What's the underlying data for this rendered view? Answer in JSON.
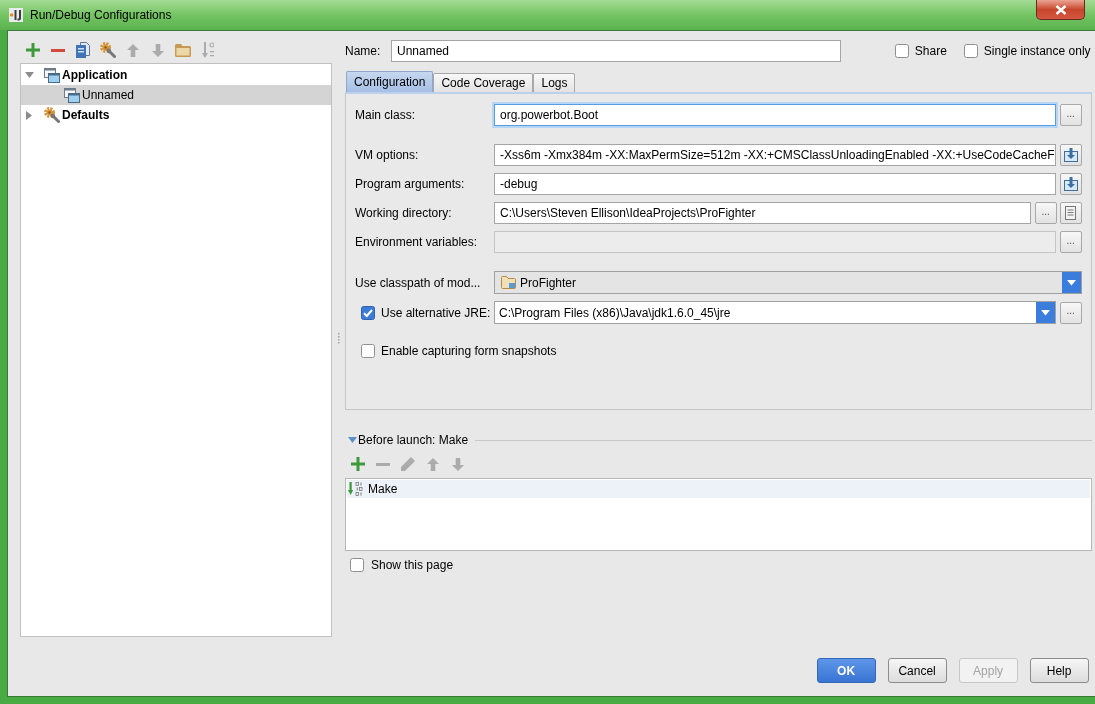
{
  "window": {
    "title": "Run/Debug Configurations"
  },
  "toolbar": [
    {
      "kind": "add",
      "disabled": false
    },
    {
      "kind": "remove",
      "disabled": false
    },
    {
      "kind": "copy",
      "disabled": false
    },
    {
      "kind": "defaults",
      "disabled": false
    },
    {
      "kind": "up",
      "disabled": true
    },
    {
      "kind": "down",
      "disabled": true
    },
    {
      "kind": "folder",
      "disabled": false
    },
    {
      "kind": "sort",
      "disabled": true
    }
  ],
  "tree": [
    {
      "kind": "config",
      "label": "Application",
      "expanded": true,
      "selected": false,
      "children": [
        {
          "kind": "config",
          "label": "Unnamed",
          "selected": true
        }
      ]
    },
    {
      "kind": "defaults",
      "label": "Defaults",
      "expanded": false,
      "selected": false
    }
  ],
  "name_field": {
    "label": "Name:",
    "value": "Unnamed"
  },
  "options": [
    {
      "label": "Share",
      "checked": false
    },
    {
      "label": "Single instance only",
      "checked": false
    }
  ],
  "tabs": [
    {
      "label": "Configuration",
      "selected": true
    },
    {
      "label": "Code Coverage",
      "selected": false
    },
    {
      "label": "Logs",
      "selected": false
    }
  ],
  "form": [
    {
      "fields": [
        {
          "kind": "text",
          "label": "Main class:",
          "value": "org.powerbot.Boot",
          "focused": true,
          "disabled": false,
          "actions": [
            {
              "kind": "browse",
              "text": "..."
            }
          ]
        }
      ]
    },
    {
      "fields": [
        {
          "kind": "text",
          "label": "VM options:",
          "value": "-Xss6m -Xmx384m -XX:MaxPermSize=512m -XX:+CMSClassUnloadingEnabled -XX:+UseCodeCacheF",
          "focused": false,
          "disabled": false,
          "actions": [
            {
              "kind": "expand"
            }
          ]
        },
        {
          "kind": "text",
          "label": "Program arguments:",
          "value": "-debug",
          "focused": false,
          "disabled": false,
          "actions": [
            {
              "kind": "expand"
            }
          ]
        },
        {
          "kind": "text",
          "label": "Working directory:",
          "value": "C:\\Users\\Steven Ellison\\IdeaProjects\\ProFighter",
          "focused": false,
          "disabled": false,
          "actions": [
            {
              "kind": "browse",
              "text": "..."
            },
            {
              "kind": "macro"
            }
          ]
        },
        {
          "kind": "text",
          "label": "Environment variables:",
          "focused": false,
          "disabled": true,
          "actions": [
            {
              "kind": "browse",
              "text": "..."
            }
          ]
        }
      ]
    },
    {
      "fields": [
        {
          "kind": "module",
          "label": "Use classpath of mod...",
          "value": "ProFighter"
        },
        {
          "kind": "path",
          "label": "Use alternative JRE:",
          "checked": true,
          "value": "C:\\Program Files (x86)\\Java\\jdk1.6.0_45\\jre",
          "actions": [
            {
              "kind": "browse",
              "text": "..."
            }
          ]
        }
      ]
    },
    {
      "fields": [
        {
          "kind": "checkbox",
          "label": "Enable capturing form snapshots",
          "checked": false
        }
      ]
    }
  ],
  "before_launch": {
    "title": "Before launch: Make",
    "expanded": true,
    "toolbar": [
      {
        "kind": "add",
        "disabled": false
      },
      {
        "kind": "remove",
        "disabled": true
      },
      {
        "kind": "edit",
        "disabled": true
      },
      {
        "kind": "up",
        "disabled": true
      },
      {
        "kind": "down",
        "disabled": true
      }
    ],
    "tasks": [
      {
        "label": "Make",
        "selected": true
      }
    ]
  },
  "show_page": {
    "label": "Show this page",
    "checked": false
  },
  "buttons": [
    {
      "label": "OK",
      "default": true,
      "disabled": false
    },
    {
      "label": "Cancel",
      "default": false,
      "disabled": false
    },
    {
      "label": "Apply",
      "default": false,
      "disabled": true
    },
    {
      "label": "Help",
      "default": false,
      "disabled": false
    }
  ]
}
